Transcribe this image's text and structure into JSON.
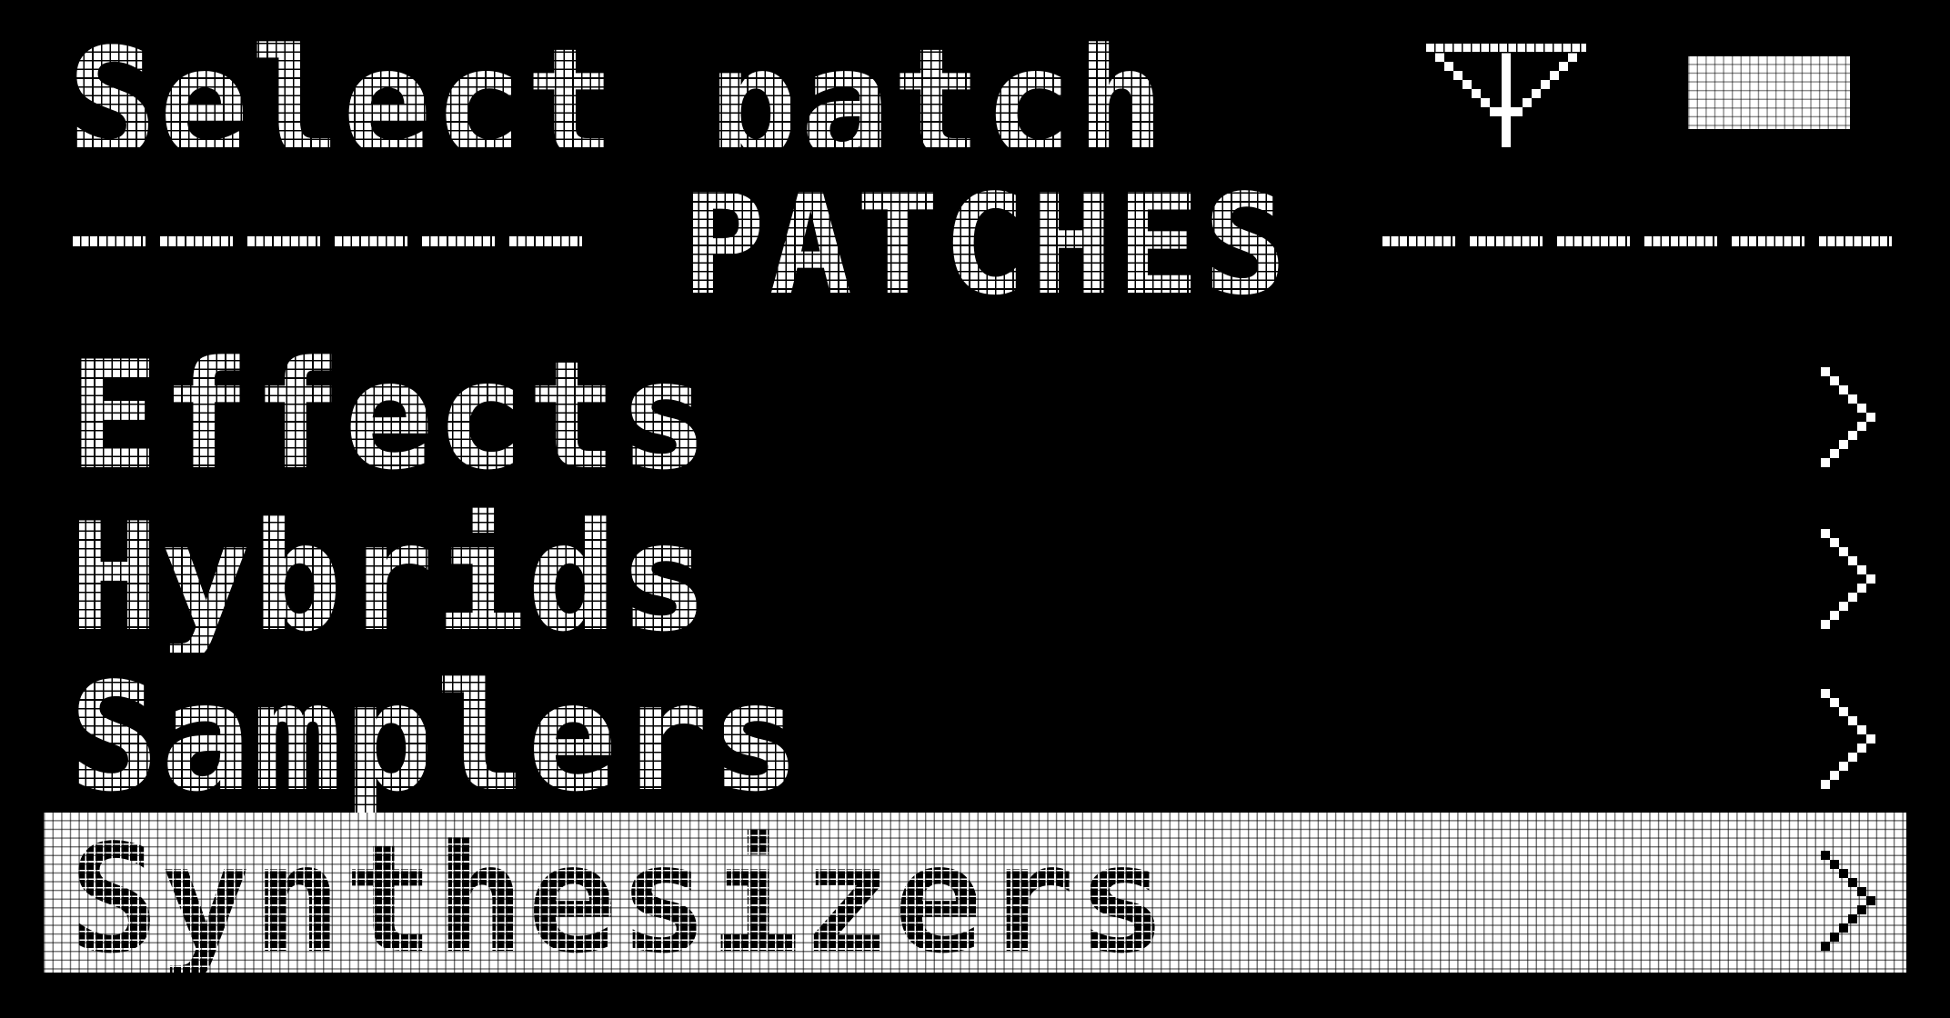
{
  "screen": {
    "title": "Select patch",
    "status": {
      "signal_icon": "antenna-icon",
      "battery_icon": "battery-icon"
    }
  },
  "section": {
    "label": "PATCHES"
  },
  "menu": {
    "items": [
      {
        "label": "Effects",
        "icon": "chevron-right-icon",
        "selected": false
      },
      {
        "label": "Hybrids",
        "icon": "chevron-right-icon",
        "selected": false
      },
      {
        "label": "Samplers",
        "icon": "chevron-right-icon",
        "selected": false
      },
      {
        "label": "Synthesizers",
        "icon": "chevron-right-icon",
        "selected": true
      }
    ]
  },
  "colors": {
    "background": "#000000",
    "foreground": "#ffffff"
  }
}
